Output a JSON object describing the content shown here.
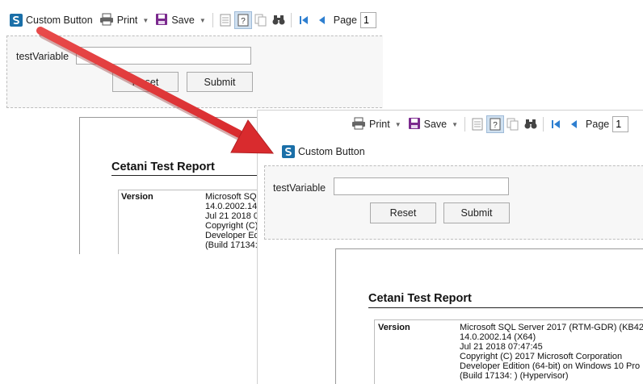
{
  "toolbar": {
    "custom_button_label": "Custom Button",
    "print_label": "Print",
    "save_label": "Save",
    "page_label": "Page",
    "page_value": "1"
  },
  "params": {
    "variable_label": "testVariable",
    "variable_value": "",
    "reset_label": "Reset",
    "submit_label": "Submit"
  },
  "report": {
    "title": "Cetani Test Report",
    "version_key": "Version",
    "version_lines_full": [
      "Microsoft SQL Server 2017 (RTM-GDR) (KB42",
      "14.0.2002.14 (X64)",
      "Jul 21 2018 07:47:45",
      "Copyright (C) 2017 Microsoft Corporation",
      "Developer Edition (64-bit) on Windows 10 Pro",
      "(Build 17134: ) (Hypervisor)"
    ],
    "version_lines_clipped": [
      "Microsoft SQL",
      "14.0.2002.14",
      "Jul 21 2018 0",
      "Copyright (C)",
      "Developer Ed",
      "(Build 17134:"
    ]
  },
  "colors": {
    "arrow": "#e8383b",
    "save_icon": "#7b2a8e",
    "nav_icon": "#2e7fd0",
    "active_bg": "#cfe0f0"
  }
}
